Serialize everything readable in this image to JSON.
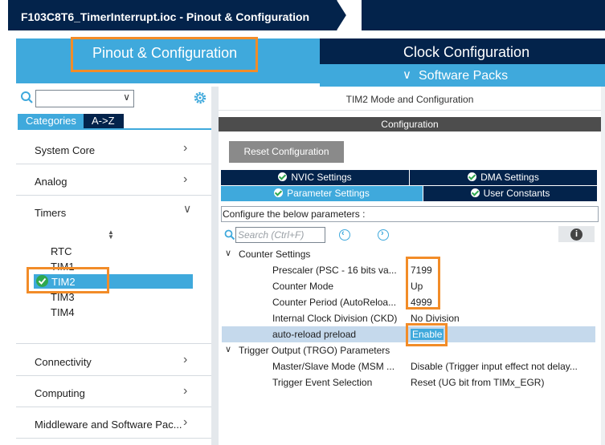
{
  "window": {
    "title": "F103C8T6_TimerInterrupt.ioc - Pinout & Configuration"
  },
  "main_tabs": {
    "pinout": "Pinout & Configuration",
    "clock": "Clock Configuration",
    "software_packs": "Software Packs"
  },
  "left": {
    "search": {
      "value": "",
      "placeholder": ""
    },
    "tabs": {
      "categories": "Categories",
      "az": "A->Z"
    },
    "categories": {
      "system_core": "System Core",
      "analog": "Analog",
      "timers": "Timers",
      "connectivity": "Connectivity",
      "computing": "Computing",
      "middleware": "Middleware and Software Pac..."
    },
    "timers": [
      "RTC",
      "TIM1",
      "TIM2",
      "TIM3",
      "TIM4"
    ],
    "selected_timer": "TIM2"
  },
  "right": {
    "mode_title": "TIM2 Mode and Configuration",
    "config_title": "Configuration",
    "reset_button": "Reset Configuration",
    "tabs": {
      "nvic": "NVIC Settings",
      "dma": "DMA Settings",
      "params": "Parameter Settings",
      "user_constants": "User Constants"
    },
    "configure_text": "Configure the below parameters :",
    "search_placeholder": "Search (Ctrl+F)",
    "groups": {
      "counter": "Counter Settings",
      "trgo": "Trigger Output (TRGO) Parameters"
    },
    "params": [
      {
        "name": "Prescaler (PSC - 16 bits va...",
        "value": "7199"
      },
      {
        "name": "Counter Mode",
        "value": "Up"
      },
      {
        "name": "Counter Period (AutoReloa...",
        "value": "4999"
      },
      {
        "name": "Internal Clock Division (CKD)",
        "value": "No Division"
      },
      {
        "name": "auto-reload preload",
        "value": "Enable"
      },
      {
        "name": "Master/Slave Mode (MSM ...",
        "value": "Disable (Trigger input effect not delay..."
      },
      {
        "name": "Trigger Event Selection",
        "value": "Reset (UG bit from TIMx_EGR)"
      }
    ]
  },
  "colors": {
    "navy": "#03234b",
    "blue": "#3fa9dc",
    "highlight": "#f28c28",
    "selection": "#c5d9ec"
  },
  "icons": [
    "search-icon",
    "gear-icon",
    "chevron-right-icon",
    "chevron-down-icon",
    "check-icon",
    "info-icon"
  ]
}
